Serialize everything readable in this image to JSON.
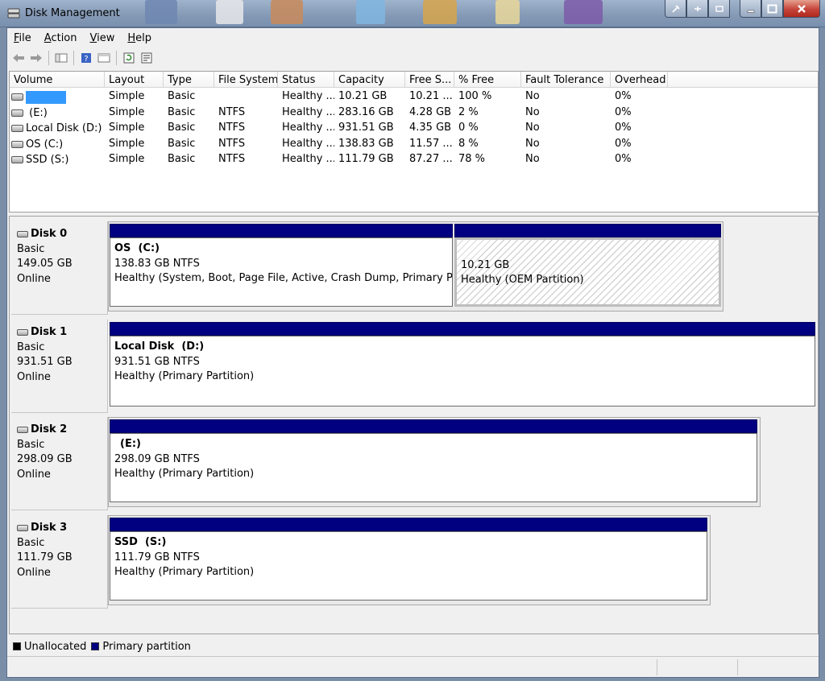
{
  "window": {
    "title": "Disk Management"
  },
  "menu": [
    {
      "label": "File",
      "key": "F",
      "rest": "ile"
    },
    {
      "label": "Action",
      "key": "A",
      "rest": "ction"
    },
    {
      "label": "View",
      "key": "V",
      "rest": "iew"
    },
    {
      "label": "Help",
      "key": "H",
      "rest": "elp"
    }
  ],
  "toolbar": [
    "back-arrow-icon",
    "forward-arrow-icon",
    "console-tree-icon",
    "help-icon",
    "properties-icon",
    "refresh-icon",
    "export-list-icon"
  ],
  "list": {
    "columns": [
      "Volume",
      "Layout",
      "Type",
      "File System",
      "Status",
      "Capacity",
      "Free S...",
      "% Free",
      "Fault Tolerance",
      "Overhead"
    ],
    "rows": [
      {
        "volume": "",
        "layout": "Simple",
        "type": "Basic",
        "fs": "",
        "status": "Healthy ...",
        "capacity": "10.21 GB",
        "free": "10.21 ...",
        "pct": "100 %",
        "fault": "No",
        "overhead": "0%",
        "selected": true
      },
      {
        "volume": " (E:)",
        "layout": "Simple",
        "type": "Basic",
        "fs": "NTFS",
        "status": "Healthy ...",
        "capacity": "283.16 GB",
        "free": "4.28 GB",
        "pct": "2 %",
        "fault": "No",
        "overhead": "0%"
      },
      {
        "volume": "Local Disk (D:)",
        "layout": "Simple",
        "type": "Basic",
        "fs": "NTFS",
        "status": "Healthy ...",
        "capacity": "931.51 GB",
        "free": "4.35 GB",
        "pct": "0 %",
        "fault": "No",
        "overhead": "0%"
      },
      {
        "volume": "OS (C:)",
        "layout": "Simple",
        "type": "Basic",
        "fs": "NTFS",
        "status": "Healthy ...",
        "capacity": "138.83 GB",
        "free": "11.57 ...",
        "pct": "8 %",
        "fault": "No",
        "overhead": "0%"
      },
      {
        "volume": "SSD (S:)",
        "layout": "Simple",
        "type": "Basic",
        "fs": "NTFS",
        "status": "Healthy ...",
        "capacity": "111.79 GB",
        "free": "87.27 ...",
        "pct": "78 %",
        "fault": "No",
        "overhead": "0%"
      }
    ]
  },
  "disks": [
    {
      "name": "Disk 0",
      "type": "Basic",
      "size": "149.05 GB",
      "status": "Online",
      "partitions": [
        {
          "title": "OS  (C:)",
          "size": "138.83 GB NTFS",
          "status": "Healthy (System, Boot, Page File, Active, Crash Dump, Primary Partiti"
        },
        {
          "title": "",
          "size": "10.21 GB",
          "status": "Healthy (OEM Partition)",
          "hatched": true
        }
      ]
    },
    {
      "name": "Disk 1",
      "type": "Basic",
      "size": "931.51 GB",
      "status": "Online",
      "partitions": [
        {
          "title": "Local Disk  (D:)",
          "size": "931.51 GB NTFS",
          "status": "Healthy (Primary Partition)"
        }
      ]
    },
    {
      "name": "Disk 2",
      "type": "Basic",
      "size": "298.09 GB",
      "status": "Online",
      "partitions": [
        {
          "title": "(E:)",
          "size": "298.09 GB NTFS",
          "status": "Healthy (Primary Partition)"
        }
      ]
    },
    {
      "name": "Disk 3",
      "type": "Basic",
      "size": "111.79 GB",
      "status": "Online",
      "partitions": [
        {
          "title": "SSD  (S:)",
          "size": "111.79 GB NTFS",
          "status": "Healthy (Primary Partition)"
        }
      ]
    }
  ],
  "legend": [
    {
      "label": "Unallocated",
      "color": "#000000"
    },
    {
      "label": "Primary partition",
      "color": "#000080"
    }
  ],
  "colors": {
    "primary_partition": "#000080",
    "selection": "#3399ff",
    "title_bar": "#8499b5"
  }
}
